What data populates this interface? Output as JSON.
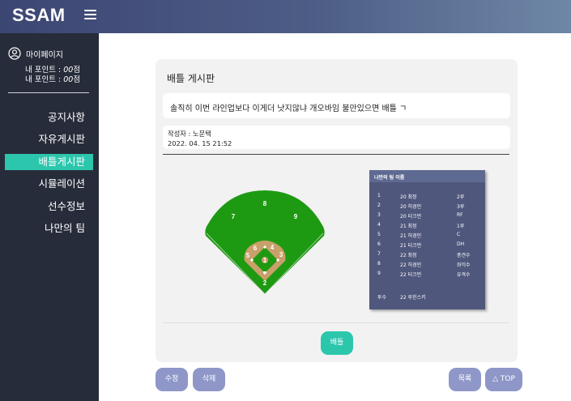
{
  "app": {
    "logo": "SSAM"
  },
  "sidebar": {
    "mypage_label": "마이페이지",
    "points": [
      {
        "label": "내 포인트 : ",
        "value": "00",
        "unit": "점"
      },
      {
        "label": "내 포인트 : ",
        "value": "00",
        "unit": "점"
      }
    ],
    "items": [
      {
        "label": "공지사항",
        "active": false
      },
      {
        "label": "자유게시판",
        "active": false
      },
      {
        "label": "배틀게시판",
        "active": true
      },
      {
        "label": "시뮬레이션",
        "active": false
      },
      {
        "label": "선수정보",
        "active": false
      },
      {
        "label": "나만의 팀",
        "active": false
      }
    ]
  },
  "post": {
    "board_title": "배틀 게시판",
    "title": "솔직히 이번 라인업보다 이게더 낫지않냐 개오바임 불만있으면 배틀 ㄱ",
    "author_label": "작성자 : 노문택",
    "date": "2022. 04. 15 21:52"
  },
  "field": {
    "positions": [
      "1",
      "2",
      "3",
      "4",
      "5",
      "6",
      "7",
      "8",
      "9"
    ],
    "colors": {
      "grass": "#1e9a12",
      "dirt": "#c9a06a"
    }
  },
  "team": {
    "title": "나만의 팀 이름",
    "players": [
      {
        "no": "1",
        "name": "20 최정",
        "pos": "2루"
      },
      {
        "no": "2",
        "name": "20 허경민",
        "pos": "3루"
      },
      {
        "no": "3",
        "name": "20 터크먼",
        "pos": "RF"
      },
      {
        "no": "4",
        "name": "21 최정",
        "pos": "1루"
      },
      {
        "no": "5",
        "name": "21 허경민",
        "pos": "C"
      },
      {
        "no": "6",
        "name": "21 터크먼",
        "pos": "DH"
      },
      {
        "no": "7",
        "name": "22 최정",
        "pos": "중견수"
      },
      {
        "no": "8",
        "name": "22 허경민",
        "pos": "좌익수"
      },
      {
        "no": "9",
        "name": "22 터크먼",
        "pos": "유격수"
      }
    ],
    "pitcher_label": "투수",
    "pitcher_name": "22 루친스키"
  },
  "buttons": {
    "battle": "배틀",
    "edit": "수정",
    "delete": "삭제",
    "list": "목록",
    "top": "△ TOP"
  }
}
